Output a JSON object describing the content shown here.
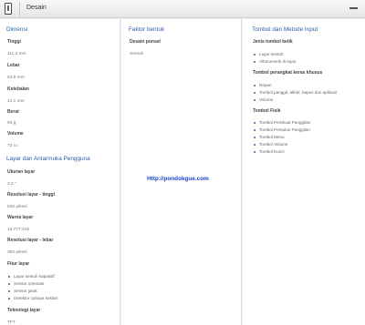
{
  "topbar": {
    "title": "Desain"
  },
  "col1": {
    "dimensi": {
      "heading": "Dimensi",
      "tinggi_label": "Tinggi",
      "tinggi_value": "111,3 mm",
      "lebar_label": "Lebar",
      "lebar_value": "53,8 mm",
      "ketebalan_label": "Ketebalan",
      "ketebalan_value": "14,1 mm",
      "berat_label": "Berat",
      "berat_value": "93 g",
      "volume_label": "Volume",
      "volume_value": "73 cc"
    },
    "layar": {
      "heading": "Layar dan Antarmuka Pengguna",
      "ukuran_label": "Ukuran layar",
      "ukuran_value": "3.2 \"",
      "res_tinggi_label": "Resolusi layar - tinggi",
      "res_tinggi_value": "640 piksel",
      "warna_label": "Warna layar",
      "warna_value": "16.777.216",
      "res_lebar_label": "Resolusi layar - lebar",
      "res_lebar_value": "360 piksel",
      "fitur_label": "Fitur layar",
      "fitur_items": [
        "Layar sentuh kapasitif",
        "Sensor orientasi",
        "Sensor jarak",
        "Detektor cahaya sekitar"
      ],
      "teknologi_label": "Teknologi layar",
      "teknologi_value": "TFT"
    }
  },
  "col2": {
    "heading": "Faktor bentuk",
    "desain_label": "Desain ponsel",
    "desain_value": "Sentuh",
    "watermark": "Http://pondokgue.com"
  },
  "col3": {
    "heading": "Tombol dan Metode Input",
    "jenis_label": "Jenis tombol ketik",
    "jenis_items": [
      "Layar sentuh",
      "Alfanumerik di layar"
    ],
    "perangkat_label": "Tombol perangkat keras khusus",
    "perangkat_items": [
      "Depan",
      "Tombol panggil, akhiri, hapus dan aplikasi",
      "Volume"
    ],
    "fisik_label": "Tombol Fisik",
    "fisik_items": [
      "Tombol Pembuat Panggilan",
      "Tombol Pemutus Panggilan",
      "Tombol Menu",
      "Tombol Volume",
      "Tombol Kunci"
    ]
  }
}
